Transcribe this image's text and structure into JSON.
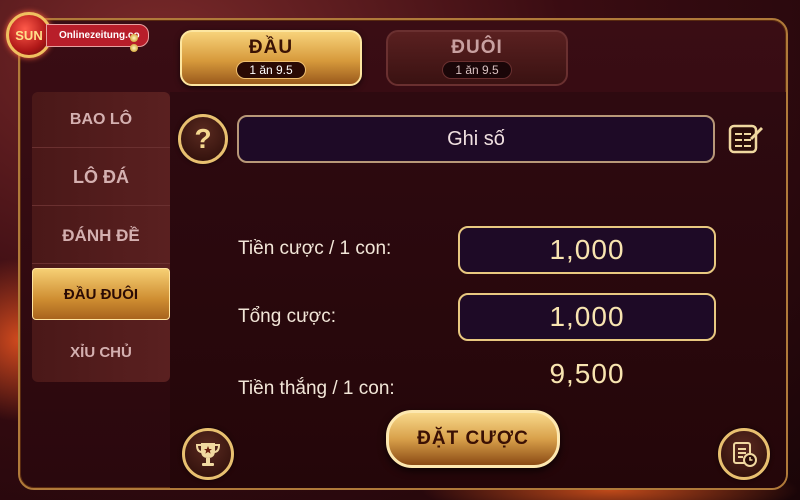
{
  "logo": {
    "brand": "SUN",
    "site": "Onlinezeitung.co"
  },
  "tabs": [
    {
      "title": "ĐẦU",
      "odds": "1 ăn 9.5",
      "active": true
    },
    {
      "title": "ĐUÔI",
      "odds": "1 ăn 9.5",
      "active": false
    }
  ],
  "sidebar": {
    "items": [
      {
        "label": "BAO LÔ",
        "active": false
      },
      {
        "label": "LÔ ĐÁ",
        "active": false
      },
      {
        "label": "ĐÁNH ĐỀ",
        "active": false
      },
      {
        "label": "ĐẦU ĐUÔI",
        "active": true
      },
      {
        "label": "XỈU CHỦ",
        "active": false
      }
    ]
  },
  "main": {
    "help_symbol": "?",
    "number_input": "Ghi số",
    "bet_per_label": "Tiền cược / 1 con:",
    "bet_per_value": "1,000",
    "total_label": "Tổng cược:",
    "total_value": "1,000",
    "win_label": "Tiền thắng / 1 con:",
    "win_value": "9,500",
    "place_bet": "ĐẶT CƯỢC"
  },
  "icons": {
    "help": "question-icon",
    "note": "notepad-icon",
    "trophy": "trophy-icon",
    "history": "history-icon"
  },
  "colors": {
    "gold": "#e8c070",
    "panel": "#2e0a10",
    "input_bg": "#1e0a26"
  }
}
